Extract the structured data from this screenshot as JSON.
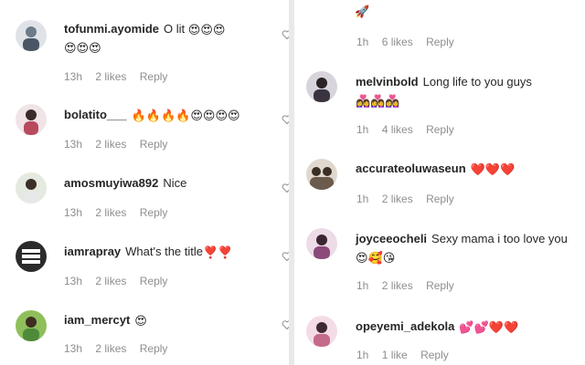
{
  "left_comments": [
    {
      "username": "tofunmi.ayomide",
      "text": "O lit",
      "emoji_line1": "😍😍😍",
      "emoji_line2": "😍😍😍",
      "time": "13h",
      "likes": "2 likes",
      "reply": "Reply",
      "avatar_color": "#6d7a8a"
    },
    {
      "username": "bolatito___",
      "text": "",
      "emoji_line1": "🔥🔥🔥🔥😍😍😍😍",
      "time": "13h",
      "likes": "2 likes",
      "reply": "Reply",
      "avatar_color": "#b84a5e"
    },
    {
      "username": "amosmuyiwa892",
      "text": "Nice",
      "time": "13h",
      "likes": "2 likes",
      "reply": "Reply",
      "avatar_color": "#556a43"
    },
    {
      "username": "iamrapray",
      "text": "What's the title",
      "emoji_line1": "❣️❣️",
      "time": "13h",
      "likes": "2 likes",
      "reply": "Reply",
      "avatar_color": "#2b2b2b"
    },
    {
      "username": "iam_mercyt",
      "text": "",
      "emoji_line1": "😍",
      "time": "13h",
      "likes": "2 likes",
      "reply": "Reply",
      "avatar_color": "#4f8a3a"
    }
  ],
  "right_comments": [
    {
      "username": "",
      "text": "",
      "emoji_line1": "🚀",
      "time": "1h",
      "likes": "6 likes",
      "reply": "Reply",
      "avatar_color": ""
    },
    {
      "username": "melvinbold",
      "text": "Long life to you guys",
      "emoji_line1": "👩‍❤️‍👩👩‍❤️‍👩👩‍❤️‍👩",
      "time": "1h",
      "likes": "4 likes",
      "reply": "Reply",
      "avatar_color": "#3a3340"
    },
    {
      "username": "accurateoluwaseun",
      "text": "",
      "emoji_line1": "❤️❤️❤️",
      "time": "1h",
      "likes": "2 likes",
      "reply": "Reply",
      "avatar_color": "#6a5b4c"
    },
    {
      "username": "joyceeocheli",
      "text": "Sexy mama i too love you",
      "emoji_line1": "😍🥰😘",
      "time": "1h",
      "likes": "2 likes",
      "reply": "Reply",
      "avatar_color": "#8c4a7a"
    },
    {
      "username": "opeyemi_adekola",
      "text": "",
      "emoji_line1": "💕💕❤️❤️",
      "time": "1h",
      "likes": "1 like",
      "reply": "Reply",
      "avatar_color": "#c46a8a"
    }
  ],
  "icons": {
    "like": "heart-outline-icon",
    "avatar": "profile-photo"
  }
}
